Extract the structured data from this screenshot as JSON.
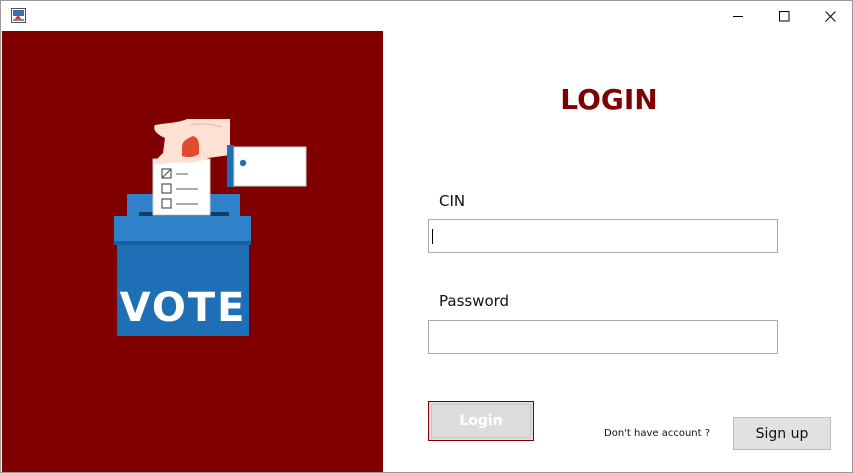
{
  "window": {
    "title_bar_icons": [
      "app-icon",
      "minimize-icon",
      "maximize-icon",
      "close-icon"
    ]
  },
  "illustration": {
    "box_text": "VOTE",
    "colors": {
      "panel_background": "#800000",
      "box_blue": "#1f6fb7",
      "box_lid": "#2f82c9",
      "sleeve_blue": "#1f6fb7",
      "hand": "#fde1d3",
      "ballot_mark": "#e04b32"
    }
  },
  "form": {
    "title": "LOGIN",
    "cin_label": "CIN",
    "cin_value": "",
    "password_label": "Password",
    "password_value": "",
    "login_label": "Login",
    "no_account_text": "Don't have account ?",
    "signup_label": "Sign up"
  },
  "colors": {
    "accent": "#800000",
    "button_gray": "#dddddd"
  }
}
